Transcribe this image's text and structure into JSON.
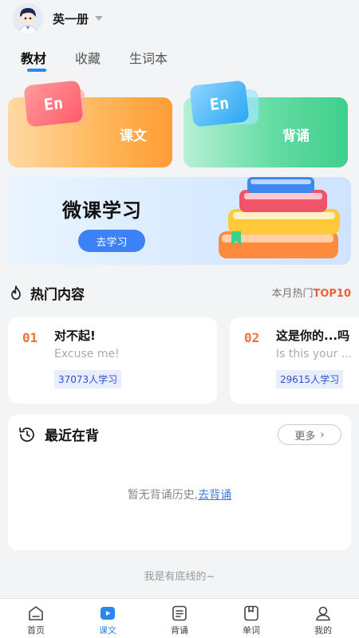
{
  "header": {
    "book_name": "英一册"
  },
  "tabs": [
    {
      "label": "教材",
      "active": true
    },
    {
      "label": "收藏",
      "active": false
    },
    {
      "label": "生词本",
      "active": false
    }
  ],
  "modules": {
    "kewen": {
      "label": "课文",
      "tile_text": "En"
    },
    "beisong": {
      "label": "背诵",
      "tile_text": "En"
    }
  },
  "banner": {
    "title": "微课学习",
    "button": "去学习"
  },
  "hot": {
    "title": "热门内容",
    "top_prefix": "本月热门",
    "top_suffix": "TOP10",
    "items": [
      {
        "num": "01",
        "cn": "对不起!",
        "en": "Excuse me!",
        "learners": "37073人学习"
      },
      {
        "num": "02",
        "cn": "这是你的...吗",
        "en": "Is this your ...",
        "learners": "29615人学习"
      }
    ]
  },
  "recent": {
    "title": "最近在背",
    "more": "更多",
    "empty_text": "暂无背诵历史,",
    "empty_link": "去背诵"
  },
  "footer_text": "我是有底线的~",
  "nav": [
    {
      "label": "首页",
      "icon": "home-icon",
      "active": false
    },
    {
      "label": "课文",
      "icon": "video-icon",
      "active": true
    },
    {
      "label": "背诵",
      "icon": "text-doc-icon",
      "active": false
    },
    {
      "label": "单词",
      "icon": "word-book-icon",
      "active": false
    },
    {
      "label": "我的",
      "icon": "user-icon",
      "active": false
    }
  ],
  "colors": {
    "accent": "#2a86f0",
    "orange": "#ff9c35",
    "green": "#3fcf8c",
    "hot": "#f05c3e"
  }
}
